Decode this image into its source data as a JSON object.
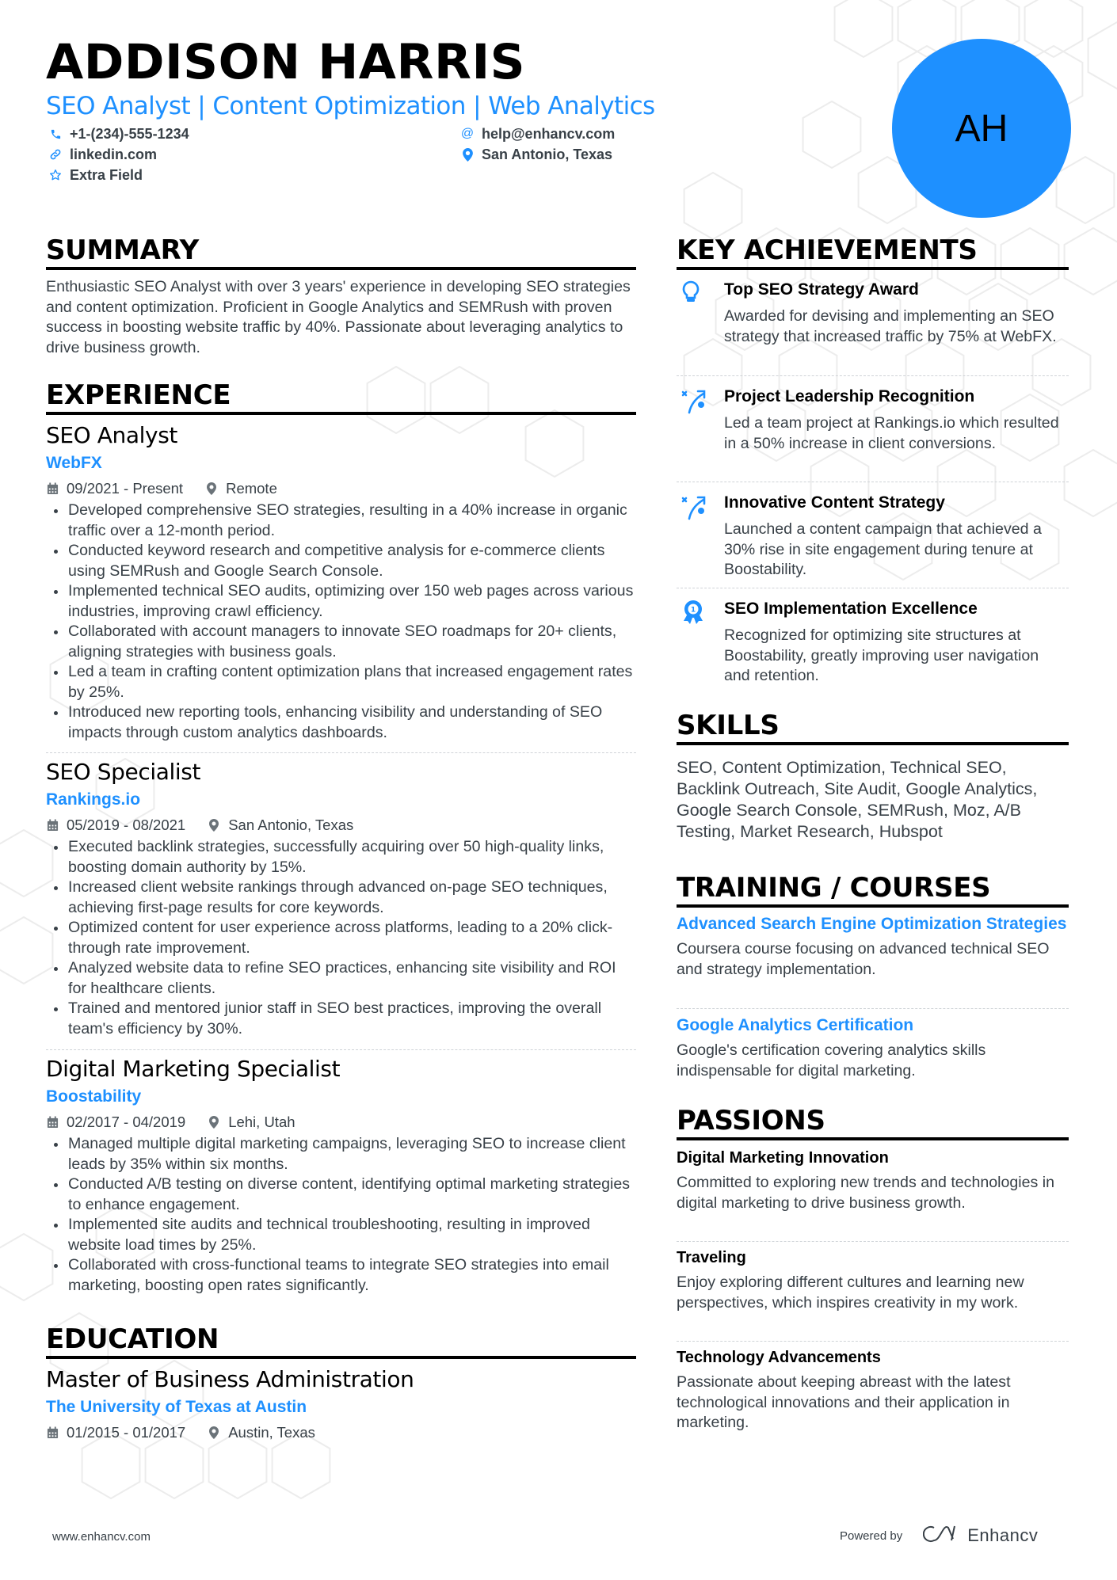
{
  "header": {
    "name": "ADDISON HARRIS",
    "headline": "SEO Analyst | Content Optimization | Web Analytics",
    "initials": "AH",
    "contacts": {
      "phone": {
        "icon": "phone-icon",
        "text": "+1-(234)-555-1234"
      },
      "email": {
        "icon": "at-icon",
        "text": "help@enhancv.com"
      },
      "linkedin": {
        "icon": "link-icon",
        "text": "linkedin.com"
      },
      "location": {
        "icon": "map-pin-icon",
        "text": "San Antonio, Texas"
      },
      "extra": {
        "icon": "star-icon",
        "text": "Extra Field"
      }
    }
  },
  "colors": {
    "accent": "#1e90ff",
    "text": "#384047",
    "heading": "#000000",
    "divider": "#cfd3d7"
  },
  "summary": {
    "title": "SUMMARY",
    "text": "Enthusiastic SEO Analyst with over 3 years' experience in developing SEO strategies and content optimization. Proficient in Google Analytics and SEMRush with proven success in boosting website traffic by 40%. Passionate about leveraging analytics to drive business growth."
  },
  "experience": {
    "title": "EXPERIENCE",
    "items": [
      {
        "role": "SEO Analyst",
        "company": "WebFX",
        "dates": "09/2021 - Present",
        "location": "Remote",
        "bullets": [
          "Developed comprehensive SEO strategies, resulting in a 40% increase in organic traffic over a 12-month period.",
          "Conducted keyword research and competitive analysis for e-commerce clients using SEMRush and Google Search Console.",
          "Implemented technical SEO audits, optimizing over 150 web pages across various industries, improving crawl efficiency.",
          "Collaborated with account managers to innovate SEO roadmaps for 20+ clients, aligning strategies with business goals.",
          "Led a team in crafting content optimization plans that increased engagement rates by 25%.",
          "Introduced new reporting tools, enhancing visibility and understanding of SEO impacts through custom analytics dashboards."
        ]
      },
      {
        "role": "SEO Specialist",
        "company": "Rankings.io",
        "dates": "05/2019 - 08/2021",
        "location": "San Antonio, Texas",
        "bullets": [
          "Executed backlink strategies, successfully acquiring over 50 high-quality links, boosting domain authority by 15%.",
          "Increased client website rankings through advanced on-page SEO techniques, achieving first-page results for core keywords.",
          "Optimized content for user experience across platforms, leading to a 20% click-through rate improvement.",
          "Analyzed website data to refine SEO practices, enhancing site visibility and ROI for healthcare clients.",
          "Trained and mentored junior staff in SEO best practices, improving the overall team's efficiency by 30%."
        ]
      },
      {
        "role": "Digital Marketing Specialist",
        "company": "Boostability",
        "dates": "02/2017 - 04/2019",
        "location": "Lehi, Utah",
        "bullets": [
          "Managed multiple digital marketing campaigns, leveraging SEO to increase client leads by 35% within six months.",
          "Conducted A/B testing on diverse content, identifying optimal marketing strategies to enhance engagement.",
          "Implemented site audits and technical troubleshooting, resulting in improved website load times by 25%.",
          "Collaborated with cross-functional teams to integrate SEO strategies into email marketing, boosting open rates significantly."
        ]
      }
    ]
  },
  "education": {
    "title": "EDUCATION",
    "degree": "Master of Business Administration",
    "school": "The University of Texas at Austin",
    "dates": "01/2015 - 01/2017",
    "location": "Austin, Texas"
  },
  "achievements": {
    "title": "KEY ACHIEVEMENTS",
    "items": [
      {
        "icon": "lightbulb-icon",
        "title": "Top SEO Strategy Award",
        "desc": "Awarded for devising and implementing an SEO strategy that increased traffic by 75% at WebFX."
      },
      {
        "icon": "strategy-icon",
        "title": "Project Leadership Recognition",
        "desc": "Led a team project at Rankings.io which resulted in a 50% increase in client conversions."
      },
      {
        "icon": "strategy-icon",
        "title": "Innovative Content Strategy",
        "desc": "Launched a content campaign that achieved a 30% rise in site engagement during tenure at Boostability."
      },
      {
        "icon": "award-medal-icon",
        "title": "SEO Implementation Excellence",
        "desc": "Recognized for optimizing site structures at Boostability, greatly improving user navigation and retention."
      }
    ]
  },
  "skills": {
    "title": "SKILLS",
    "text": "SEO, Content Optimization, Technical SEO, Backlink Outreach, Site Audit, Google Analytics, Google Search Console, SEMRush, Moz, A/B Testing, Market Research, Hubspot"
  },
  "training": {
    "title": "TRAINING / COURSES",
    "items": [
      {
        "title": "Advanced Search Engine Optimization Strategies",
        "desc": "Coursera course focusing on advanced technical SEO and strategy implementation."
      },
      {
        "title": "Google Analytics Certification",
        "desc": "Google's certification covering analytics skills indispensable for digital marketing."
      }
    ]
  },
  "passions": {
    "title": "PASSIONS",
    "items": [
      {
        "title": "Digital Marketing Innovation",
        "desc": "Committed to exploring new trends and technologies in digital marketing to drive business growth."
      },
      {
        "title": "Traveling",
        "desc": "Enjoy exploring different cultures and learning new perspectives, which inspires creativity in my work."
      },
      {
        "title": "Technology Advancements",
        "desc": "Passionate about keeping abreast with the latest technological innovations and their application in marketing."
      }
    ]
  },
  "footer": {
    "website": "www.enhancv.com",
    "powered_by": "Powered by",
    "brand": "Enhancv"
  }
}
